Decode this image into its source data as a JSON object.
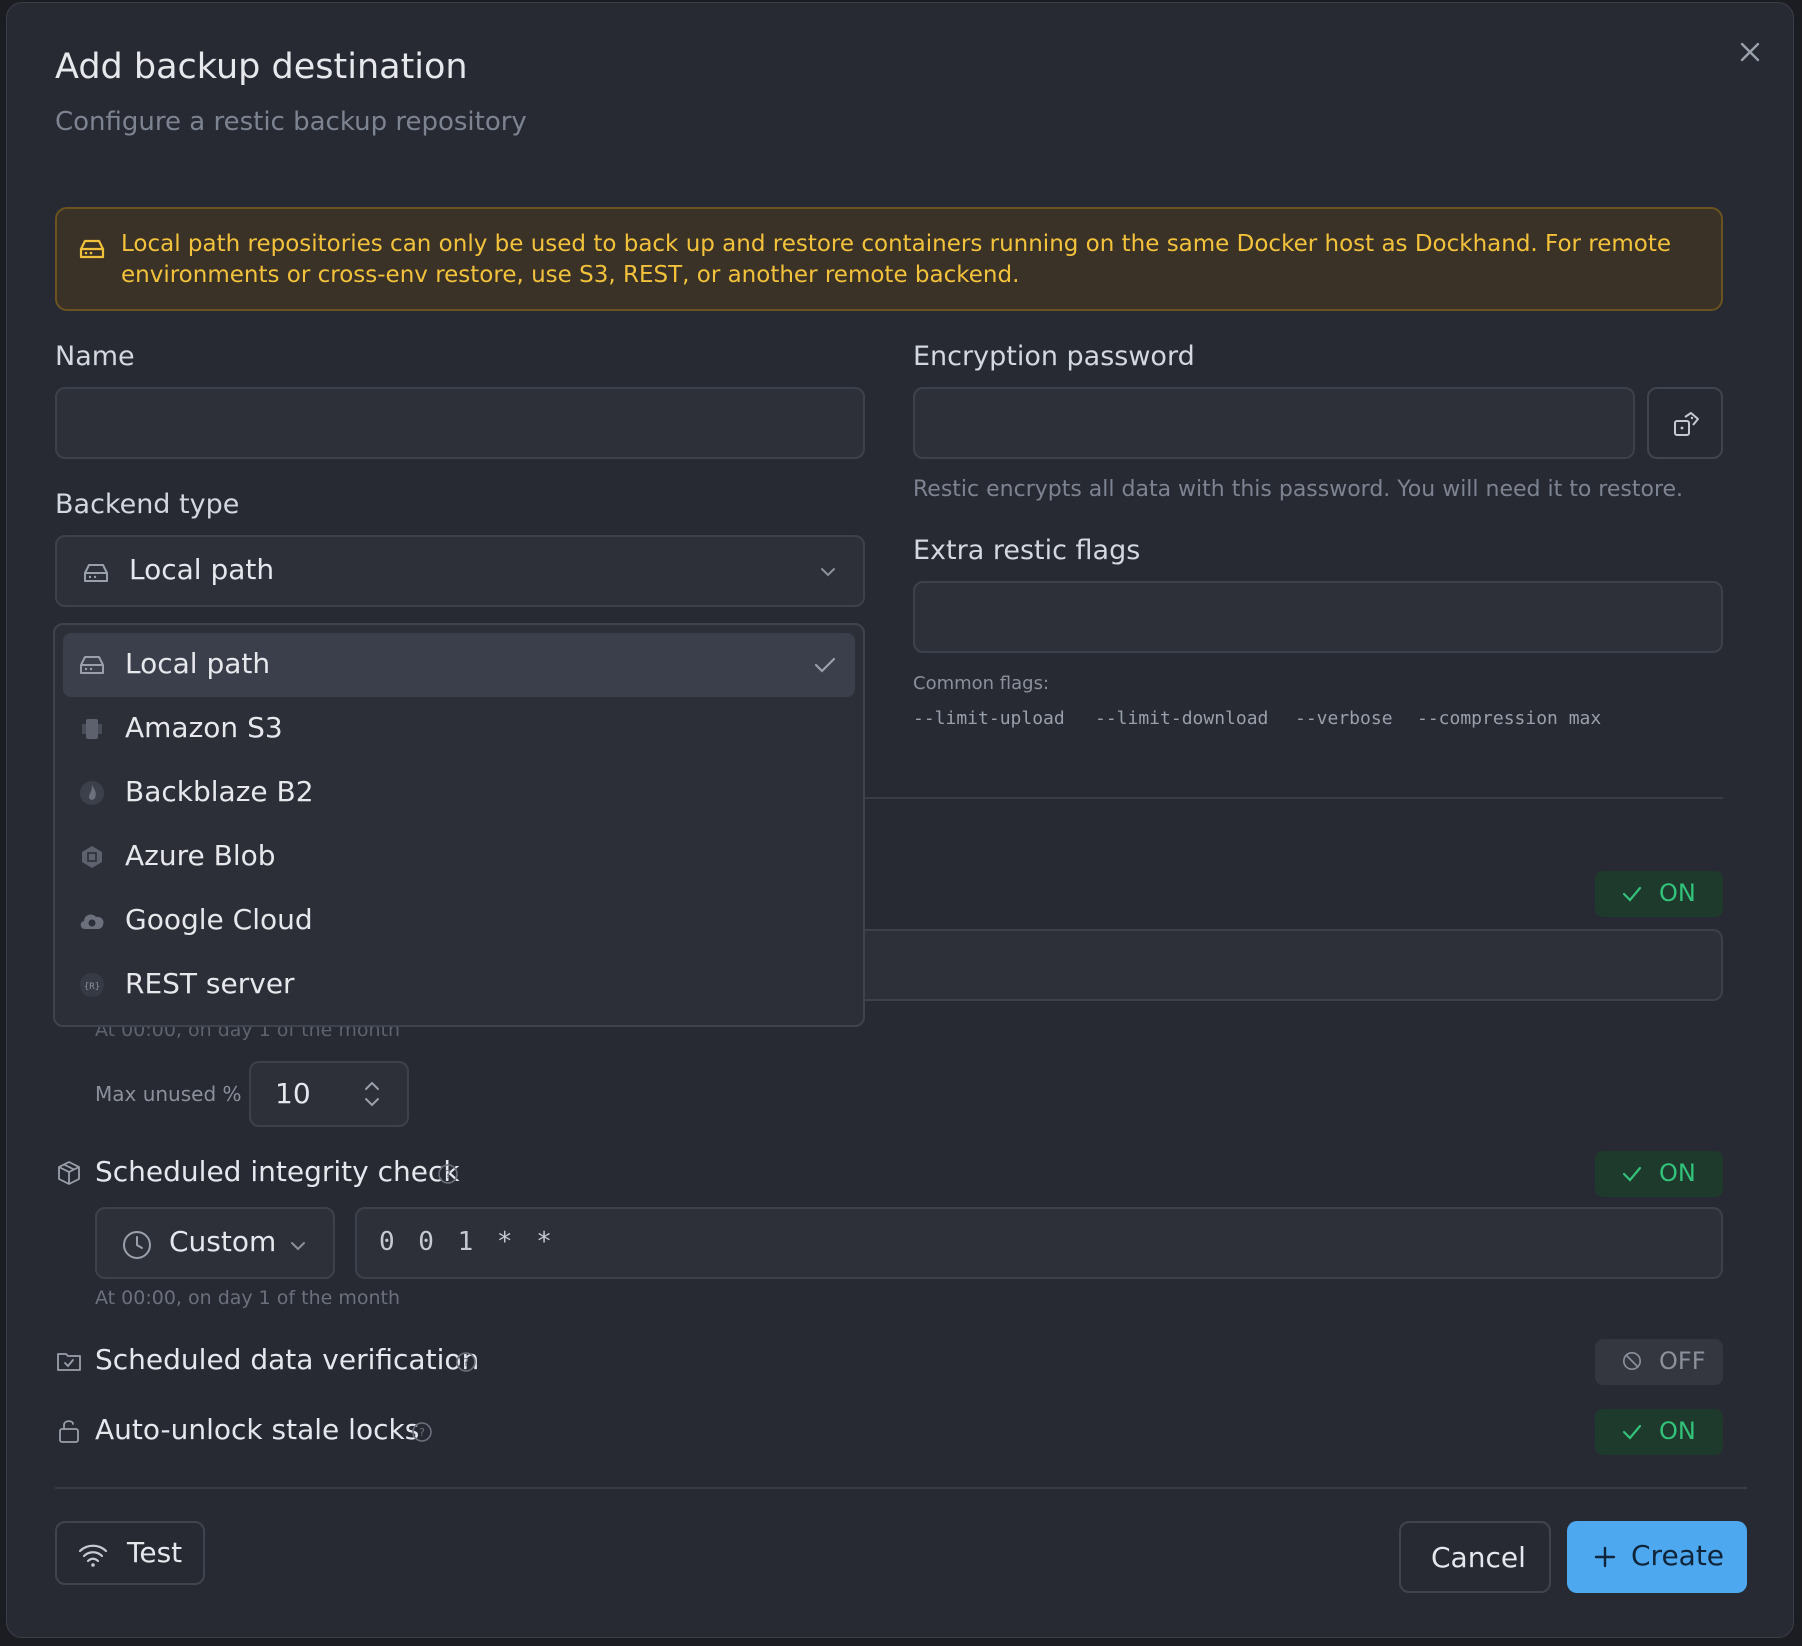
{
  "dialog": {
    "title": "Add backup destination",
    "subtitle": "Configure a restic backup repository",
    "close_icon": "close-icon"
  },
  "warning": {
    "icon": "hard-drive-icon",
    "text": "Local path repositories can only be used to back up and restore containers running on the same Docker host as Dockhand. For remote environments or cross-env restore, use S3, REST, or another remote backend."
  },
  "form": {
    "name": {
      "label": "Name",
      "value": "",
      "placeholder": ""
    },
    "encryption": {
      "label": "Encryption password",
      "value": "",
      "help": "Restic encrypts all data with this password. You will need it to restore.",
      "generate_icon": "dice-icon"
    },
    "backend": {
      "label": "Backend type",
      "selected": "Local path",
      "options": [
        {
          "label": "Local path",
          "icon": "hard-drive-icon",
          "selected": true
        },
        {
          "label": "Amazon S3",
          "icon": "amazon-s3-icon",
          "selected": false
        },
        {
          "label": "Backblaze B2",
          "icon": "backblaze-icon",
          "selected": false
        },
        {
          "label": "Azure Blob",
          "icon": "azure-icon",
          "selected": false
        },
        {
          "label": "Google Cloud",
          "icon": "google-cloud-icon",
          "selected": false
        },
        {
          "label": "REST server",
          "icon": "rest-server-icon",
          "selected": false
        }
      ]
    },
    "extra_flags": {
      "label": "Extra restic flags",
      "value": "",
      "common_label": "Common flags:",
      "common": [
        "--limit-upload",
        "--limit-download",
        "--verbose",
        "--compression max"
      ]
    },
    "prune": {
      "toggle": "ON",
      "schedule_hint": "At 00:00, on day 1 of the month",
      "max_unused_label": "Max unused %",
      "max_unused_value": "10"
    },
    "integrity_check": {
      "title": "Scheduled integrity check",
      "toggle": "ON",
      "schedule_mode": "Custom",
      "cron": "0 0 1 * *",
      "hint": "At 00:00, on day 1 of the month"
    },
    "data_verification": {
      "title": "Scheduled data verification",
      "toggle": "OFF"
    },
    "auto_unlock": {
      "title": "Auto-unlock stale locks",
      "toggle": "ON"
    }
  },
  "footer": {
    "test_label": "Test",
    "cancel_label": "Cancel",
    "create_label": "Create"
  },
  "colors": {
    "accent": "#4da8ef",
    "on": "#33c27a",
    "warning": "#f3c23c",
    "background": "#272a33"
  }
}
